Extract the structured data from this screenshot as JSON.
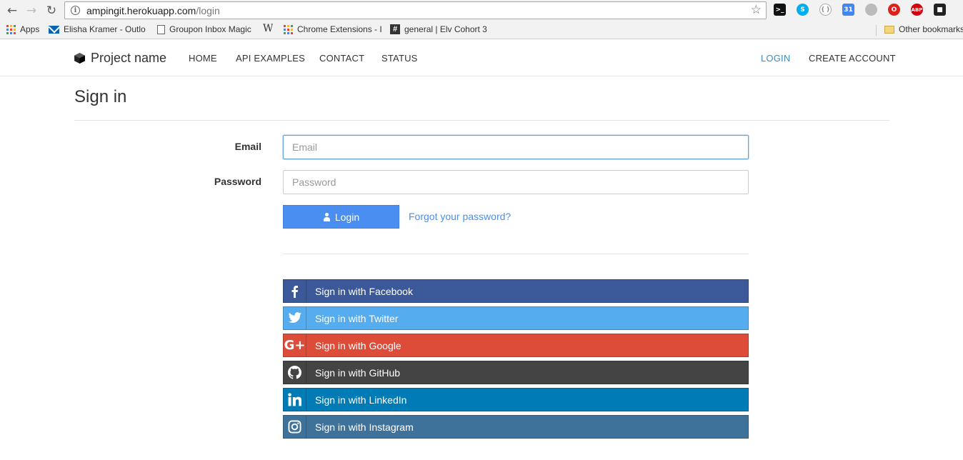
{
  "browser": {
    "url_host": "ampingit.herokuapp.com",
    "url_path": "/login",
    "bookmarks": [
      {
        "label": "Apps",
        "icon": "apps-grid-icon"
      },
      {
        "label": "Elisha Kramer - Outlo",
        "icon": "mail-icon"
      },
      {
        "label": "Groupon Inbox Magic",
        "icon": "page-icon"
      },
      {
        "label": "",
        "icon": "wikipedia-icon"
      },
      {
        "label": "Chrome Extensions - I",
        "icon": "apps-grid-icon"
      },
      {
        "label": "general | Elv Cohort 3",
        "icon": "slack-icon"
      }
    ],
    "other_bookmarks": "Other bookmarks",
    "wiki_glyph": "W",
    "slack_glyph": "#"
  },
  "navbar": {
    "brand": "Project name",
    "links": [
      "HOME",
      "API EXAMPLES",
      "CONTACT",
      "STATUS"
    ],
    "right_links": [
      "LOGIN",
      "CREATE ACCOUNT"
    ]
  },
  "page": {
    "title": "Sign in",
    "email_label": "Email",
    "email_placeholder": "Email",
    "password_label": "Password",
    "password_placeholder": "Password",
    "login_button": "Login",
    "forgot_link": "Forgot your password?"
  },
  "social": [
    {
      "label": "Sign in with Facebook",
      "icon": "facebook-icon",
      "color": "#3b5998"
    },
    {
      "label": "Sign in with Twitter",
      "icon": "twitter-icon",
      "color": "#55acee"
    },
    {
      "label": "Sign in with Google",
      "icon": "google-plus-icon",
      "color": "#dd4b39"
    },
    {
      "label": "Sign in with GitHub",
      "icon": "github-icon",
      "color": "#444444"
    },
    {
      "label": "Sign in with LinkedIn",
      "icon": "linkedin-icon",
      "color": "#007bb6"
    },
    {
      "label": "Sign in with Instagram",
      "icon": "instagram-icon",
      "color": "#3f729b"
    }
  ],
  "colors": {
    "accent": "#4b8ef1",
    "active_nav": "#3c8dbc"
  }
}
